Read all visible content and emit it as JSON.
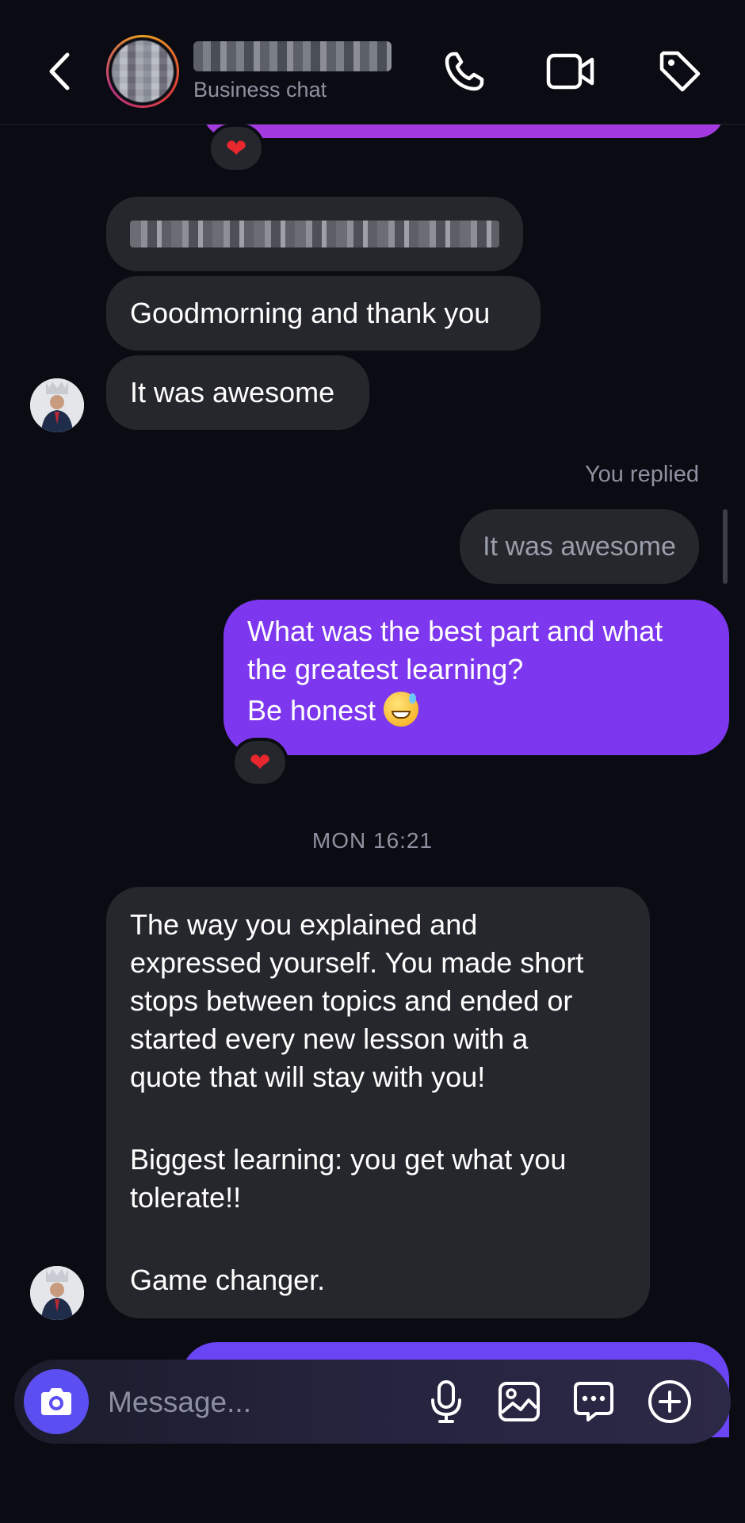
{
  "header": {
    "subtitle": "Business chat",
    "icons": {
      "back": "chevron-left-icon",
      "call": "phone-icon",
      "video": "video-camera-icon",
      "tag": "tag-icon"
    }
  },
  "messages": {
    "incoming_1": "Goodmorning and thank you",
    "incoming_2": "It was awesome",
    "reply_label": "You replied",
    "reply_quote": "It was awesome",
    "outgoing": {
      "line1": "What was the best part and what",
      "line2": "the greatest learning?",
      "line3": "Be honest"
    },
    "reaction": "❤",
    "timestamp": "MON 16:21",
    "long": {
      "line1": "The way you explained and",
      "line2": "expressed yourself. You made short",
      "line3": "stops between topics and ended or",
      "line4": "started every new lesson with a",
      "line5": "quote that will stay with you!",
      "line6": "Biggest learning: you get what you",
      "line7": "tolerate!!",
      "line8": "Game changer."
    }
  },
  "composer": {
    "placeholder": "Message...",
    "icons": [
      "camera-icon",
      "microphone-icon",
      "image-icon",
      "sticker-icon",
      "plus-icon"
    ]
  },
  "colors": {
    "background": "#0b0c13",
    "incoming_bubble": "#25272d",
    "outgoing_bubble": "#7d38ef",
    "accent": "#5b4ff2"
  }
}
